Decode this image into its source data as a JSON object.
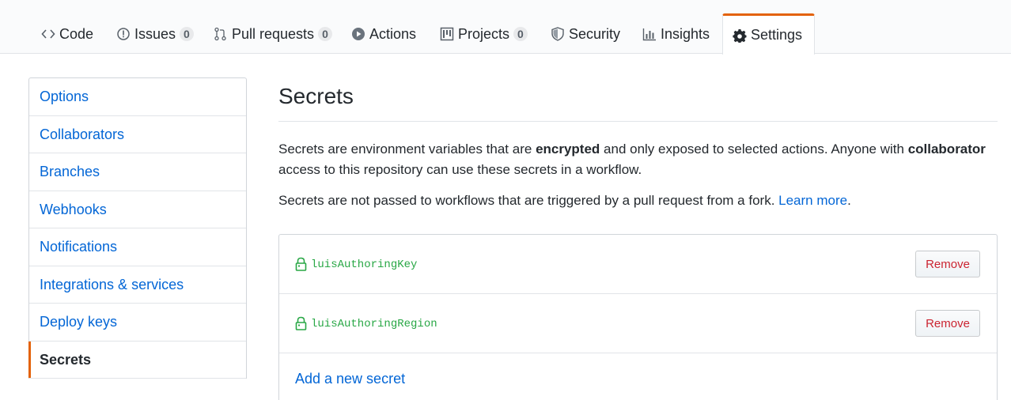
{
  "nav": {
    "tabs": [
      {
        "label": "Code",
        "icon": "code-icon"
      },
      {
        "label": "Issues",
        "icon": "issue-icon",
        "count": "0"
      },
      {
        "label": "Pull requests",
        "icon": "pull-request-icon",
        "count": "0"
      },
      {
        "label": "Actions",
        "icon": "play-icon"
      },
      {
        "label": "Projects",
        "icon": "project-icon",
        "count": "0"
      },
      {
        "label": "Security",
        "icon": "shield-icon"
      },
      {
        "label": "Insights",
        "icon": "graph-icon"
      },
      {
        "label": "Settings",
        "icon": "gear-icon",
        "selected": true
      }
    ],
    "accent": "#e36209"
  },
  "sidebar": {
    "items": [
      {
        "label": "Options"
      },
      {
        "label": "Collaborators"
      },
      {
        "label": "Branches"
      },
      {
        "label": "Webhooks"
      },
      {
        "label": "Notifications"
      },
      {
        "label": "Integrations & services"
      },
      {
        "label": "Deploy keys"
      },
      {
        "label": "Secrets",
        "selected": true
      }
    ]
  },
  "main": {
    "title": "Secrets",
    "p1": {
      "t1": "Secrets are environment variables that are ",
      "b1": "encrypted",
      "t2": " and only exposed to selected actions. Anyone with ",
      "b2": "collaborator",
      "t3": " access to this repository can use these secrets in a workflow."
    },
    "p2": {
      "text": "Secrets are not passed to workflows that are triggered by a pull request from a fork. ",
      "link": "Learn more",
      "end": "."
    },
    "secrets": [
      {
        "name": "luisAuthoringKey",
        "action": "Remove"
      },
      {
        "name": "luisAuthoringRegion",
        "action": "Remove"
      }
    ],
    "add_label": "Add a new secret"
  }
}
